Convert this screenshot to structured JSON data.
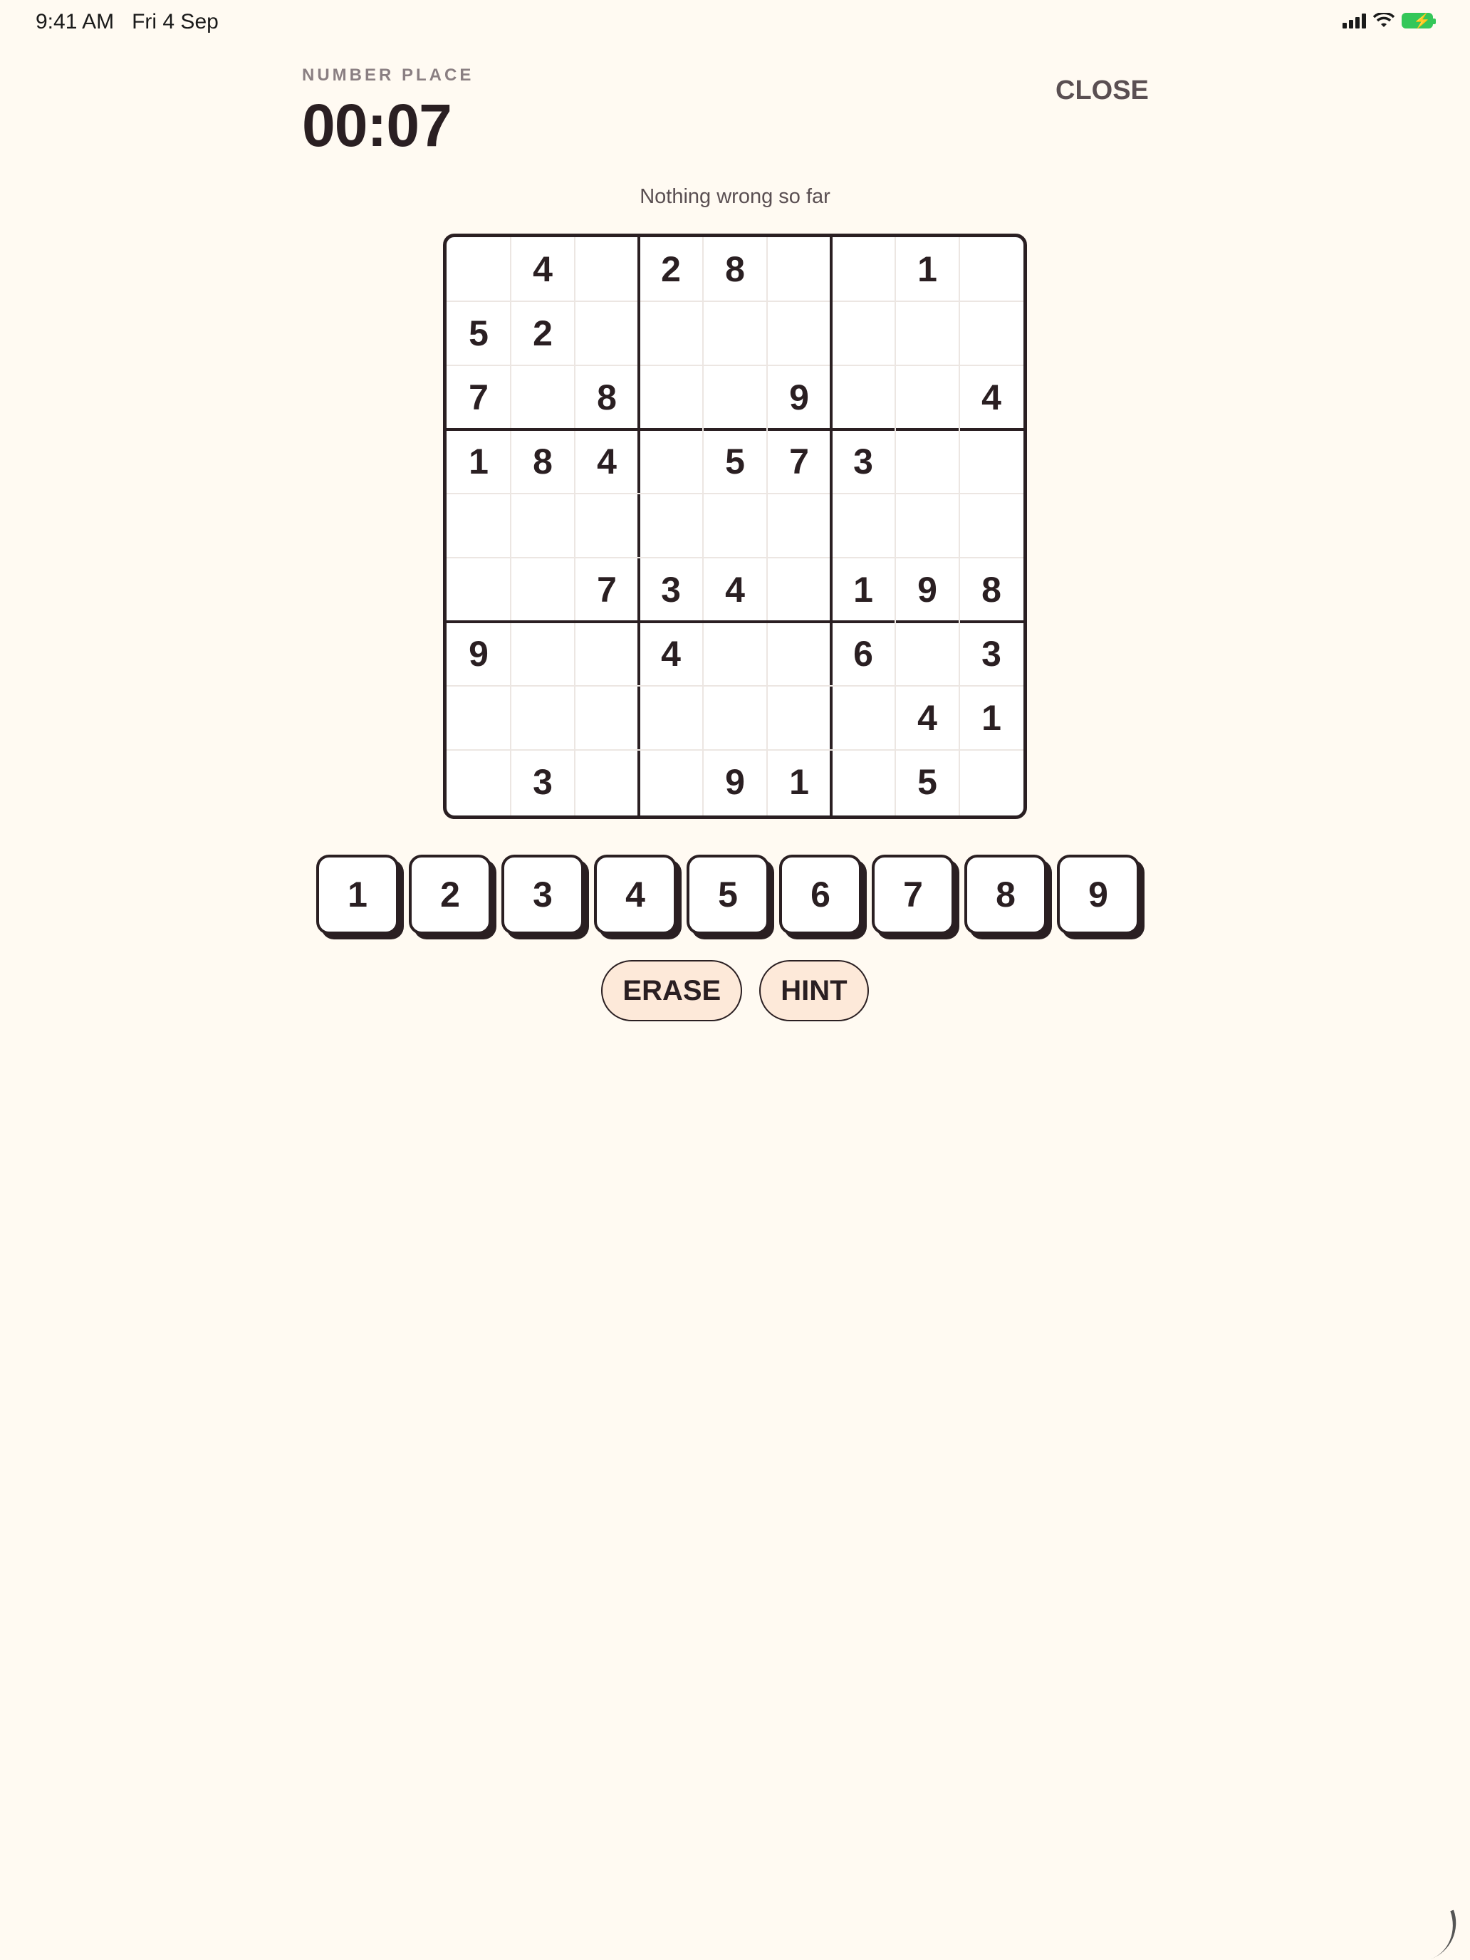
{
  "status_bar": {
    "time": "9:41 AM",
    "date": "Fri 4 Sep",
    "icons": [
      "signal-icon",
      "wifi-icon",
      "battery-charging-icon"
    ]
  },
  "header": {
    "app_label": "NUMBER PLACE",
    "timer": "00:07",
    "close_label": "CLOSE"
  },
  "status_message": "Nothing wrong so far",
  "board": {
    "grid": [
      [
        "",
        "4",
        "",
        "2",
        "8",
        "",
        "",
        "1",
        ""
      ],
      [
        "5",
        "2",
        "",
        "",
        "",
        "",
        "",
        "",
        ""
      ],
      [
        "7",
        "",
        "8",
        "",
        "",
        "9",
        "",
        "",
        "4"
      ],
      [
        "1",
        "8",
        "4",
        "",
        "5",
        "7",
        "3",
        "",
        ""
      ],
      [
        "",
        "",
        "",
        "",
        "",
        "",
        "",
        "",
        ""
      ],
      [
        "",
        "",
        "7",
        "3",
        "4",
        "",
        "1",
        "9",
        "8"
      ],
      [
        "9",
        "",
        "",
        "4",
        "",
        "",
        "6",
        "",
        "3"
      ],
      [
        "",
        "",
        "",
        "",
        "",
        "",
        "",
        "4",
        "1"
      ],
      [
        "",
        "3",
        "",
        "",
        "9",
        "1",
        "",
        "5",
        ""
      ]
    ]
  },
  "keypad": {
    "keys": [
      "1",
      "2",
      "3",
      "4",
      "5",
      "6",
      "7",
      "8",
      "9"
    ]
  },
  "actions": {
    "erase_label": "ERASE",
    "hint_label": "HINT"
  },
  "colors": {
    "background": "#fffaf2",
    "ink": "#2a1f22",
    "pill": "#fde9d9"
  }
}
